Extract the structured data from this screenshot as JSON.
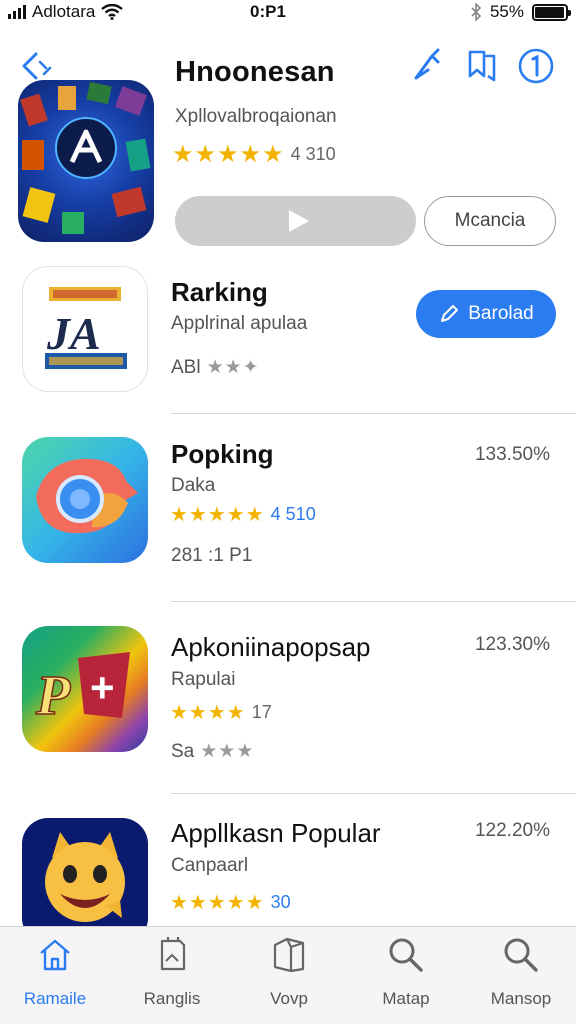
{
  "status_bar": {
    "carrier": "Adlotara",
    "time": "0:P1",
    "battery": "55%",
    "battery_level": 0.95
  },
  "featured": {
    "title": "Hnoonesan",
    "subtitle": "Xpllovalbroqaionan",
    "rating": "4 310",
    "button_label": "Mcancia"
  },
  "apps": [
    {
      "title": "Rarking",
      "subtitle": "Applrinal apulaa",
      "meta": "ABl",
      "button_label": "Barolad"
    },
    {
      "title": "Popking",
      "subtitle": "Daka",
      "rating": "4 510",
      "meta": "281 :1 P1",
      "percent": "133.50%"
    },
    {
      "title": "Apkoniinapopsap",
      "subtitle": "Rapulai",
      "rating": "17",
      "meta": "Sa",
      "percent": "123.30%"
    },
    {
      "title": "Appllkasn Popular",
      "subtitle": "Canpaarl",
      "rating": "30",
      "percent": "122.20%"
    }
  ],
  "tabs": [
    {
      "label": "Ramaile",
      "icon": "home-icon",
      "active": true
    },
    {
      "label": "Ranglis",
      "icon": "document-icon"
    },
    {
      "label": "Vovp",
      "icon": "box-icon"
    },
    {
      "label": "Matap",
      "icon": "search-icon"
    },
    {
      "label": "Mansop",
      "icon": "search-icon"
    }
  ],
  "colors": {
    "accent": "#2b7cf0",
    "star": "#f2b400",
    "button_grey": "#cdcdcd"
  }
}
